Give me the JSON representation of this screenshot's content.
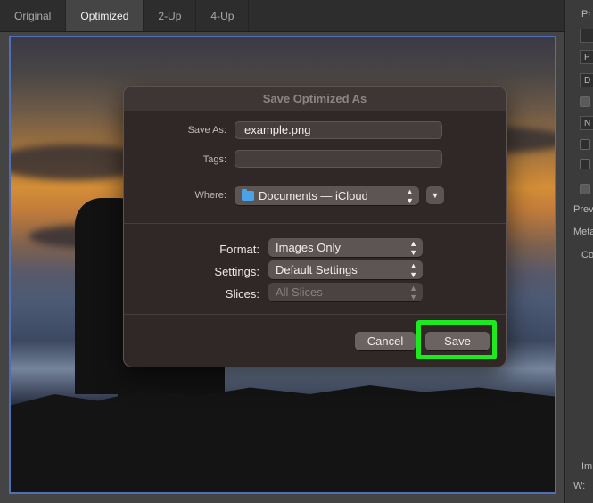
{
  "tabs": [
    {
      "label": "Original",
      "active": false
    },
    {
      "label": "Optimized",
      "active": true
    },
    {
      "label": "2-Up",
      "active": false
    },
    {
      "label": "4-Up",
      "active": false
    }
  ],
  "right_panel": {
    "texts": [
      "Pr",
      "P",
      "D",
      "N",
      "Prev",
      "Meta",
      "Co",
      "Im",
      "W:"
    ]
  },
  "dialog": {
    "title": "Save Optimized As",
    "save_as_label": "Save As:",
    "save_as_value": "example.png",
    "tags_label": "Tags:",
    "tags_value": "",
    "where_label": "Where:",
    "where_value": "Documents — iCloud",
    "expand_icon": "chevron-down-icon",
    "format_label": "Format:",
    "format_value": "Images Only",
    "settings_label": "Settings:",
    "settings_value": "Default Settings",
    "slices_label": "Slices:",
    "slices_value": "All Slices",
    "cancel_label": "Cancel",
    "save_label": "Save"
  },
  "highlight_color": "#1ee81e",
  "accent_frame_color": "#4f6fb8"
}
